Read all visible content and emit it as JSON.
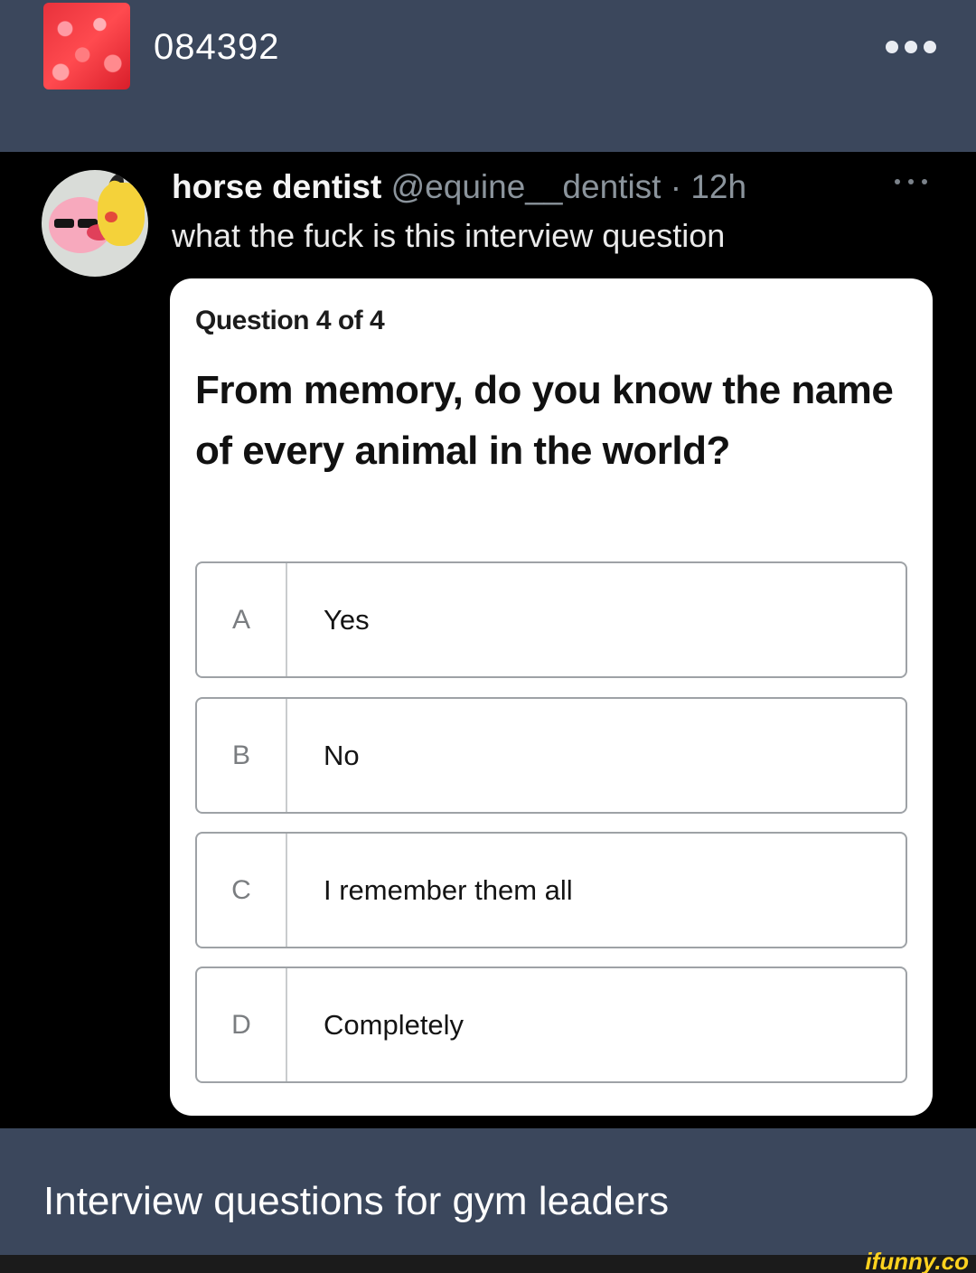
{
  "header": {
    "blog_name": "084392",
    "avatar_icon": "blog-avatar-red-texture",
    "more_icon": "more-dots-icon"
  },
  "tweet": {
    "author_name": "horse dentist",
    "handle": "@equine__dentist",
    "separator": " · ",
    "time": "12h",
    "text": "what the fuck is this interview question",
    "avatar_icon": "kirby-pikachu-avatar"
  },
  "quiz": {
    "counter": "Question 4 of 4",
    "question": "From memory, do you know the name of every animal in the world?",
    "options": [
      {
        "letter": "A",
        "text": "Yes"
      },
      {
        "letter": "B",
        "text": "No"
      },
      {
        "letter": "C",
        "text": "I remember them all"
      },
      {
        "letter": "D",
        "text": "Completely"
      }
    ]
  },
  "caption": "Interview questions for gym leaders",
  "watermark": "ifunny.co",
  "colors": {
    "header_bg": "#3b475c",
    "tweet_bg": "#000000",
    "card_bg": "#ffffff",
    "watermark": "#ffd21f"
  }
}
